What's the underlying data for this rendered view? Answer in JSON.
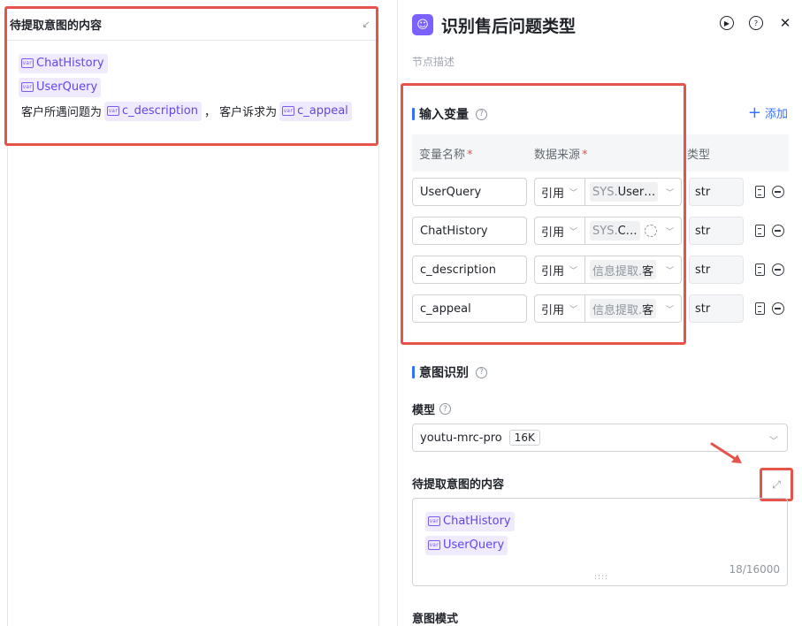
{
  "left_editor": {
    "title": "待提取意图的内容",
    "collapse_icon": "collapse-arrows-icon",
    "lines": [
      [
        {
          "type": "var",
          "text": "ChatHistory"
        }
      ],
      [
        {
          "type": "var",
          "text": "UserQuery"
        }
      ],
      [
        {
          "type": "text",
          "text": "客户所遇问题为"
        },
        {
          "type": "var",
          "text": "c_description"
        },
        {
          "type": "text",
          "text": "， 客户诉求为"
        },
        {
          "type": "var",
          "text": "c_appeal"
        }
      ]
    ]
  },
  "node": {
    "title": "识别售后问题类型",
    "description_placeholder": "节点描述",
    "actions": [
      "run-icon",
      "help-icon",
      "close-icon"
    ]
  },
  "input_vars": {
    "title": "输入变量",
    "add_label": "添加",
    "headers": {
      "name": "变量名称",
      "source": "数据来源",
      "type": "类型"
    },
    "rows": [
      {
        "name": "UserQuery",
        "ref": "引用",
        "src_prefix": "SYS.",
        "src_suffix": "User…",
        "has_gear": false,
        "type": "str"
      },
      {
        "name": "ChatHistory",
        "ref": "引用",
        "src_prefix": "SYS.",
        "src_suffix": "C…",
        "has_gear": true,
        "type": "str"
      },
      {
        "name": "c_description",
        "ref": "引用",
        "src_prefix": "信息提取.",
        "src_suffix": "客",
        "has_gear": false,
        "type": "str"
      },
      {
        "name": "c_appeal",
        "ref": "引用",
        "src_prefix": "信息提取.",
        "src_suffix": "客",
        "has_gear": false,
        "type": "str"
      }
    ]
  },
  "intent": {
    "title": "意图识别",
    "model_label": "模型",
    "model_value": "youtu-mrc-pro",
    "model_ctx": "16K",
    "content_label": "待提取意图的内容",
    "content_vars": [
      "ChatHistory",
      "UserQuery"
    ],
    "counter": "18/16000",
    "mode_label": "意图模式"
  },
  "colors": {
    "accent": "#3370ff",
    "highlight": "#e5534b",
    "var_chip_bg": "#efeafd",
    "var_chip_text": "#6446e6",
    "node_logo": "#7b61ff"
  }
}
